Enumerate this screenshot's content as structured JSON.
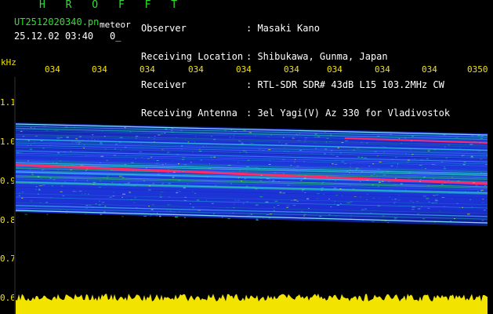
{
  "app": {
    "title": "H R O F F T",
    "filename": "UT2512020340.pn",
    "meteor_label": "meteor",
    "datetime": "25.12.02 03:40",
    "count": "0_"
  },
  "header": {
    "rows": [
      {
        "label": "Observer",
        "value": ": Masaki Kano"
      },
      {
        "label": "Receiving Location",
        "value": ": Shibukawa, Gunma, Japan"
      },
      {
        "label": "Receiver",
        "value": ": RTL-SDR SDR# 43dB L15 103.2MHz CW"
      },
      {
        "label": "Receiving Antenna",
        "value": ": 3el Yagi(V) Az 330 for Vladivostok"
      }
    ]
  },
  "axes": {
    "y_unit": "kHz",
    "y_ticks": [
      "1.1",
      "1.0",
      "0.9",
      "0.8",
      "0.7",
      "0.6"
    ],
    "x_ticks": [
      "034",
      "034",
      "034",
      "034",
      "034",
      "034",
      "034",
      "034",
      "034",
      "0350"
    ]
  },
  "colors": {
    "header_text": "#ffffff",
    "title_green": "#2fe02f",
    "axis_yellow": "#f2e300",
    "carrier_red": "#ff2a6a",
    "noise_yellow": "#f2e300",
    "spectrum_blue": "#1a2fd0"
  }
}
